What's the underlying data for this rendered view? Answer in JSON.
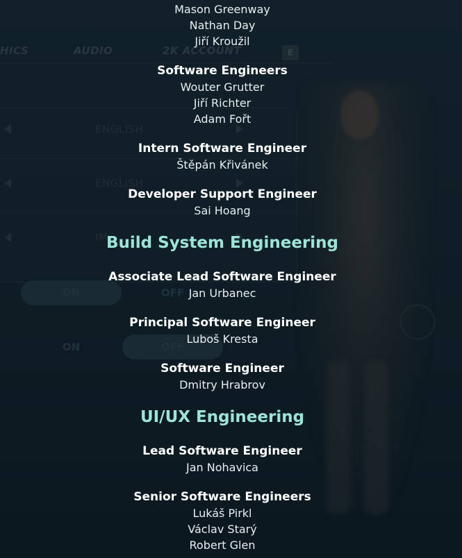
{
  "background_menu": {
    "tabs": [
      "HICS",
      "AUDIO",
      "2K ACCOUNT"
    ],
    "key_hint": "E",
    "options": [
      "ENGLISH",
      "ENGLISH",
      "IM"
    ],
    "toggle_rows": [
      {
        "on": "ON",
        "off": "OFF"
      },
      {
        "on": "ON",
        "off": "OFF"
      }
    ]
  },
  "credits": {
    "top_names": [
      "Mason Greenway",
      "Nathan Day",
      "Jiří Kroužil"
    ],
    "software_engineers": {
      "role": "Software Engineers",
      "names": [
        "Wouter Grutter",
        "Jiří Richter",
        "Adam Fořt"
      ]
    },
    "intern": {
      "role": "Intern Software Engineer",
      "names": [
        "Štěpán Křivánek"
      ]
    },
    "dev_support": {
      "role": "Developer Support Engineer",
      "names": [
        "Sai Hoang"
      ]
    },
    "build_system": {
      "title": "Build System Engineering",
      "associate_lead": {
        "role": "Associate Lead Software Engineer",
        "names": [
          "Jan Urbanec"
        ]
      },
      "principal": {
        "role": "Principal Software Engineer",
        "names": [
          "Luboš Kresta"
        ]
      },
      "engineer": {
        "role": "Software Engineer",
        "names": [
          "Dmitry Hrabrov"
        ]
      }
    },
    "ui_ux": {
      "title": "UI/UX Engineering",
      "lead": {
        "role": "Lead Software Engineer",
        "names": [
          "Jan Nohavica"
        ]
      },
      "senior": {
        "role": "Senior Software Engineers",
        "names": [
          "Lukáš Pirkl",
          "Václav Starý",
          "Robert Glen"
        ]
      }
    }
  },
  "colors": {
    "background": "#0d1a22",
    "section_title": "#9ee4d6",
    "role_text": "#ffffff",
    "name_text": "#e9eef0"
  }
}
